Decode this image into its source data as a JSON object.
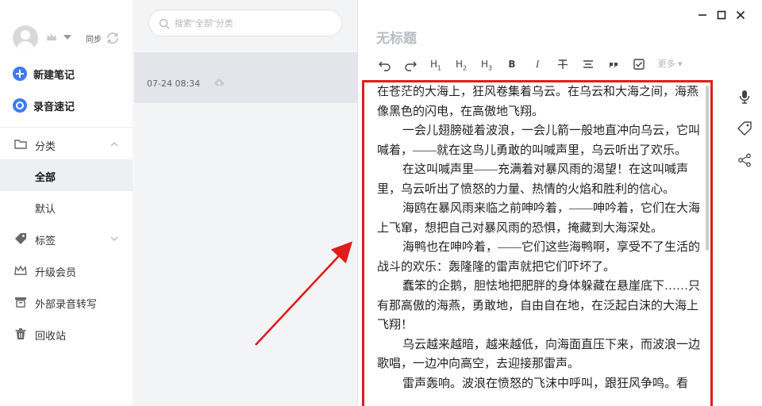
{
  "sidebar": {
    "sync_label": "同步",
    "actions": [
      {
        "label": "新建笔记",
        "icon": "plus-circle-icon"
      },
      {
        "label": "录音速记",
        "icon": "record-circle-icon"
      }
    ],
    "nav": [
      {
        "label": "分类",
        "icon": "folder-icon"
      },
      {
        "label": "全部",
        "icon": ""
      },
      {
        "label": "默认",
        "icon": ""
      },
      {
        "label": "标签",
        "icon": "tag-icon"
      },
      {
        "label": "升级会员",
        "icon": "crown-icon"
      },
      {
        "label": "外部录音转写",
        "icon": "transcribe-icon"
      },
      {
        "label": "回收站",
        "icon": "trash-icon"
      }
    ]
  },
  "list": {
    "search_placeholder": "搜索\"全部\"分类",
    "notes": [
      {
        "date": "07-24 08:34"
      }
    ]
  },
  "editor": {
    "title": "无标题",
    "toolbar": {
      "h1": "H",
      "h1_sub": "1",
      "h2": "H",
      "h2_sub": "2",
      "h3": "H",
      "h3_sub": "3",
      "bold": "B",
      "italic": "I",
      "more": "更多"
    },
    "paragraphs": [
      "在苍茫的大海上，狂风卷集着乌云。在乌云和大海之间，海燕像黑色的闪电，在高傲地飞翔。",
      "一会儿翅膀碰着波浪，一会儿箭一般地直冲向乌云，它叫喊着，——就在这鸟儿勇敢的叫喊声里，乌云听出了欢乐。",
      "在这叫喊声里——充满着对暴风雨的渴望！在这叫喊声里，乌云听出了愤怒的力量、热情的火焰和胜利的信心。",
      "海鸥在暴风雨来临之前呻吟着，——呻吟着，它们在大海上飞窜，想把自己对暴风雨的恐惧，掩藏到大海深处。",
      "海鸭也在呻吟着，——它们这些海鸭啊，享受不了生活的战斗的欢乐：轰隆隆的雷声就把它们吓坏了。",
      "蠢笨的企鹅，胆怯地把肥胖的身体躲藏在悬崖底下……只有那高傲的海燕，勇敢地，自由自在地，在泛起白沫的大海上飞翔！",
      "乌云越来越暗，越来越低，向海面直压下来，而波浪一边歌唱，一边冲向高空，去迎接那雷声。",
      "雷声轰响。波浪在愤怒的飞沫中呼叫，跟狂风争鸣。看"
    ]
  },
  "colors": {
    "accent": "#3e7bf0",
    "highlight_border": "#e01c1c",
    "arrow": "#e01c1c"
  }
}
